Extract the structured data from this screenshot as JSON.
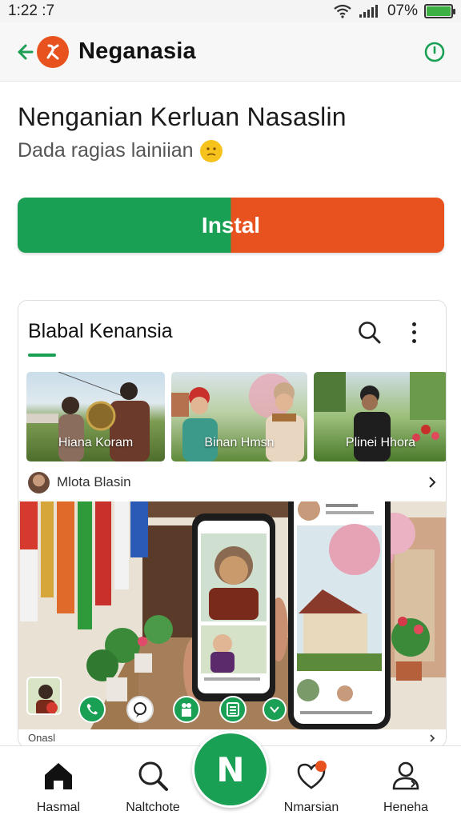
{
  "status_bar": {
    "time": "1:22 :7",
    "battery_percent": "07%",
    "icons": [
      "wifi-icon",
      "signal-icon",
      "battery-icon"
    ]
  },
  "app_bar": {
    "title": "Neganasia",
    "logo_icon": "app-logo-icon",
    "right_icon": "info-circle-icon"
  },
  "header": {
    "headline": "Nenganian Kerluan Nasaslin",
    "subline": "Dada ragias lainiian",
    "emoji": "face-emoji-icon"
  },
  "install_button": {
    "label": "Instal"
  },
  "card": {
    "title": "Blabal Kenansia",
    "thumbnails": [
      {
        "label": "Hiana Koram"
      },
      {
        "label": "Binan Hmsn"
      },
      {
        "label": "Plinei Hhora"
      }
    ],
    "author": "Mlota Blasin",
    "caption": "Onasl"
  },
  "bottom_nav": {
    "items": [
      {
        "label": "Hasmal",
        "icon": "home-icon"
      },
      {
        "label": "Naltchote",
        "icon": "search-icon"
      },
      {
        "label": "Nmarsian",
        "icon": "heart-notification-icon"
      },
      {
        "label": "Heneha",
        "icon": "profile-icon"
      }
    ],
    "fab_text": "N"
  },
  "colors": {
    "green": "#1aa054",
    "orange": "#e8521f"
  }
}
